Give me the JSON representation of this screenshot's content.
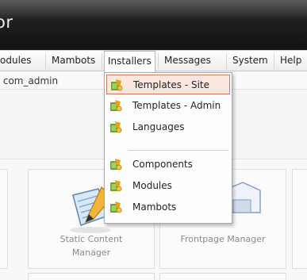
{
  "app": {
    "title": "or"
  },
  "menubar": {
    "items": [
      {
        "label": "odules"
      },
      {
        "label": "Mambots"
      },
      {
        "label": "Installers"
      },
      {
        "label": "Messages"
      },
      {
        "label": "System"
      },
      {
        "label": "Help"
      }
    ],
    "active_item": "Installers"
  },
  "pathbar": {
    "text": "/ com_admin"
  },
  "installers_menu": {
    "items": [
      {
        "label": "Templates - Site",
        "icon": "installer-icon",
        "highlighted": true
      },
      {
        "label": "Templates - Admin",
        "icon": "installer-icon"
      },
      {
        "label": "Languages",
        "icon": "installer-icon"
      },
      {
        "label": "Components",
        "icon": "installer-icon"
      },
      {
        "label": "Modules",
        "icon": "installer-icon"
      },
      {
        "label": "Mambots",
        "icon": "installer-icon"
      }
    ]
  },
  "cpanel": {
    "tiles": [
      {
        "label": "Static Content\nManager",
        "icon": "static-content-icon"
      },
      {
        "label": "Frontpage Manager",
        "icon": "frontpage-icon"
      }
    ]
  },
  "colors": {
    "header_dark": "#121212",
    "highlight_bg": "#fbe7df",
    "highlight_border": "#d07a5c",
    "installer_green": "#6aa52b",
    "installer_orange": "#e8a11d"
  }
}
